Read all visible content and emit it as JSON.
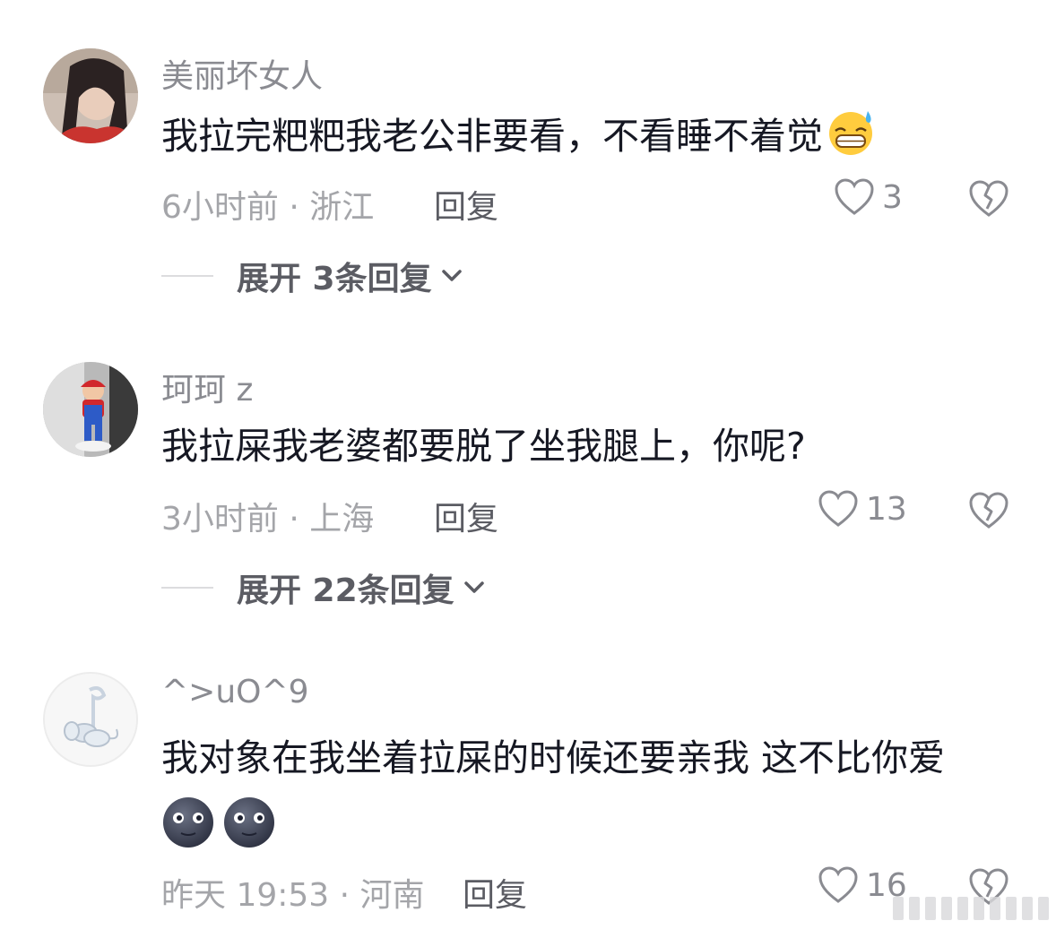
{
  "comments": [
    {
      "username": "美丽坏女人",
      "content": "我拉完粑粑我老公非要看，不看睡不着觉",
      "content_emoji": "grinning-sweat-emoji",
      "time_location": "6小时前 · 浙江",
      "reply_label": "回复",
      "like_count": "3",
      "expand_label": "展开 3条回复"
    },
    {
      "username": "珂珂 z",
      "content": "我拉屎我老婆都要脱了坐我腿上，你呢?",
      "time_location": "3小时前 · 上海",
      "reply_label": "回复",
      "like_count": "13",
      "expand_label": "展开 22条回复"
    },
    {
      "username": "^>uO^9",
      "content": "我对象在我坐着拉屎的时候还要亲我 这不比你爱",
      "content_emojis": [
        "new-moon-face-emoji",
        "new-moon-face-emoji"
      ],
      "time_location": "昨天 19:53 · 河南",
      "reply_label": "回复",
      "like_count": "16"
    }
  ],
  "icons": {
    "like": "heart-outline-icon",
    "dislike": "broken-heart-icon",
    "expand": "chevron-down-icon"
  },
  "colors": {
    "text_primary": "#161823",
    "text_secondary": "#8a8b91",
    "reply": "#5b5c63"
  }
}
